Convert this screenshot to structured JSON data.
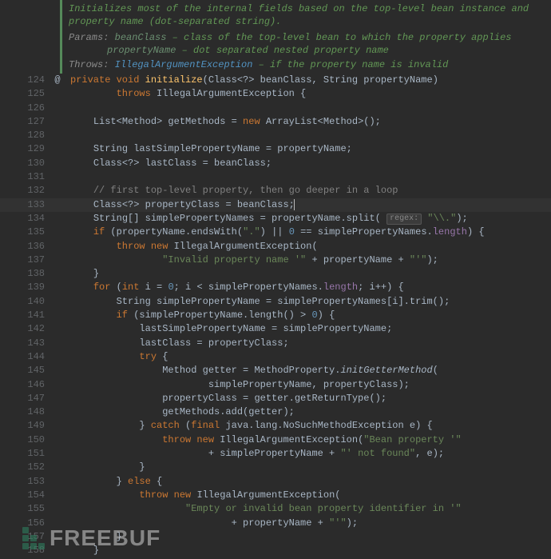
{
  "javadoc": {
    "summary": "Initializes most of the internal fields based on the top-level bean instance and property name (dot-separated string).",
    "params_label": "Params:",
    "params": [
      {
        "name": "beanClass",
        "desc": "– class of the top-level bean to which the property applies"
      },
      {
        "name": "propertyName",
        "desc": "– dot separated nested property name"
      }
    ],
    "throws_label": "Throws:",
    "throws": {
      "exception": "IllegalArgumentException",
      "desc": "– if the property name is invalid"
    }
  },
  "change_marker": "@",
  "lines": [
    {
      "n": 124,
      "indent": 0,
      "segs": [
        {
          "t": "private ",
          "c": "kw"
        },
        {
          "t": "void ",
          "c": "kw"
        },
        {
          "t": "initialize",
          "c": "mth"
        },
        {
          "t": "(Class<?> beanClass, String propertyName)"
        }
      ]
    },
    {
      "n": 125,
      "indent": 8,
      "segs": [
        {
          "t": "throws ",
          "c": "kw"
        },
        {
          "t": "IllegalArgumentException {"
        }
      ]
    },
    {
      "n": 126,
      "indent": 0,
      "segs": []
    },
    {
      "n": 127,
      "indent": 4,
      "segs": [
        {
          "t": "List<Method> getMethods = "
        },
        {
          "t": "new ",
          "c": "kw"
        },
        {
          "t": "ArrayList<Method>();"
        }
      ]
    },
    {
      "n": 128,
      "indent": 0,
      "segs": []
    },
    {
      "n": 129,
      "indent": 4,
      "segs": [
        {
          "t": "String lastSimplePropertyName = propertyName;"
        }
      ]
    },
    {
      "n": 130,
      "indent": 4,
      "segs": [
        {
          "t": "Class<?> lastClass = beanClass;"
        }
      ]
    },
    {
      "n": 131,
      "indent": 0,
      "segs": []
    },
    {
      "n": 132,
      "indent": 4,
      "segs": [
        {
          "t": "// first top-level property, then go deeper in a loop",
          "c": "cmt"
        }
      ]
    },
    {
      "n": 133,
      "indent": 4,
      "hl": true,
      "segs": [
        {
          "t": "Class<?> propertyClass = beanClass;"
        },
        {
          "t": "",
          "caret": true
        }
      ]
    },
    {
      "n": 134,
      "indent": 4,
      "segs": [
        {
          "t": "String[] simplePropertyNames = propertyName.split( "
        },
        {
          "t": "",
          "regex": "regex:"
        },
        {
          "t": " "
        },
        {
          "t": "\"",
          "c": "str"
        },
        {
          "t": "\\\\.",
          "c": "str"
        },
        {
          "t": "\"",
          "c": "str"
        },
        {
          "t": ");"
        }
      ]
    },
    {
      "n": 135,
      "indent": 4,
      "segs": [
        {
          "t": "if ",
          "c": "kw"
        },
        {
          "t": "(propertyName.endsWith("
        },
        {
          "t": "\".\"",
          "c": "str"
        },
        {
          "t": ") || "
        },
        {
          "t": "0",
          "c": "num"
        },
        {
          "t": " == simplePropertyNames."
        },
        {
          "t": "length",
          "c": "fld"
        },
        {
          "t": ") {"
        }
      ]
    },
    {
      "n": 136,
      "indent": 8,
      "segs": [
        {
          "t": "throw new ",
          "c": "kw"
        },
        {
          "t": "IllegalArgumentException("
        }
      ]
    },
    {
      "n": 137,
      "indent": 16,
      "segs": [
        {
          "t": "\"Invalid property name '\"",
          "c": "str"
        },
        {
          "t": " + propertyName + "
        },
        {
          "t": "\"'\"",
          "c": "str"
        },
        {
          "t": ");"
        }
      ]
    },
    {
      "n": 138,
      "indent": 4,
      "segs": [
        {
          "t": "}"
        }
      ]
    },
    {
      "n": 139,
      "indent": 4,
      "segs": [
        {
          "t": "for ",
          "c": "kw"
        },
        {
          "t": "("
        },
        {
          "t": "int ",
          "c": "kw"
        },
        {
          "t": "i = "
        },
        {
          "t": "0",
          "c": "num"
        },
        {
          "t": "; i < simplePropertyNames."
        },
        {
          "t": "length",
          "c": "fld"
        },
        {
          "t": "; i++) {"
        }
      ]
    },
    {
      "n": 140,
      "indent": 8,
      "segs": [
        {
          "t": "String simplePropertyName = simplePropertyNames[i].trim();"
        }
      ]
    },
    {
      "n": 141,
      "indent": 8,
      "segs": [
        {
          "t": "if ",
          "c": "kw"
        },
        {
          "t": "(simplePropertyName.length() > "
        },
        {
          "t": "0",
          "c": "num"
        },
        {
          "t": ") {"
        }
      ]
    },
    {
      "n": 142,
      "indent": 12,
      "segs": [
        {
          "t": "lastSimplePropertyName = simplePropertyName;"
        }
      ]
    },
    {
      "n": 143,
      "indent": 12,
      "segs": [
        {
          "t": "lastClass = propertyClass;"
        }
      ]
    },
    {
      "n": 144,
      "indent": 12,
      "segs": [
        {
          "t": "try ",
          "c": "kw"
        },
        {
          "t": "{"
        }
      ]
    },
    {
      "n": 145,
      "indent": 16,
      "segs": [
        {
          "t": "Method getter = MethodProperty."
        },
        {
          "t": "initGetterMethod",
          "c": "ital"
        },
        {
          "t": "("
        }
      ]
    },
    {
      "n": 146,
      "indent": 24,
      "segs": [
        {
          "t": "simplePropertyName, propertyClass);"
        }
      ]
    },
    {
      "n": 147,
      "indent": 16,
      "segs": [
        {
          "t": "propertyClass = getter.getReturnType();"
        }
      ]
    },
    {
      "n": 148,
      "indent": 16,
      "segs": [
        {
          "t": "getMethods.add(getter);"
        }
      ]
    },
    {
      "n": 149,
      "indent": 12,
      "segs": [
        {
          "t": "} "
        },
        {
          "t": "catch ",
          "c": "kw"
        },
        {
          "t": "("
        },
        {
          "t": "final ",
          "c": "kw"
        },
        {
          "t": "java.lang.NoSuchMethodException e) {"
        }
      ]
    },
    {
      "n": 150,
      "indent": 16,
      "segs": [
        {
          "t": "throw new ",
          "c": "kw"
        },
        {
          "t": "IllegalArgumentException("
        },
        {
          "t": "\"Bean property '\"",
          "c": "str"
        }
      ]
    },
    {
      "n": 151,
      "indent": 24,
      "segs": [
        {
          "t": "+ simplePropertyName + "
        },
        {
          "t": "\"' not found\"",
          "c": "str"
        },
        {
          "t": ", e);"
        }
      ]
    },
    {
      "n": 152,
      "indent": 12,
      "segs": [
        {
          "t": "}"
        }
      ]
    },
    {
      "n": 153,
      "indent": 8,
      "segs": [
        {
          "t": "} "
        },
        {
          "t": "else ",
          "c": "kw"
        },
        {
          "t": "{"
        }
      ]
    },
    {
      "n": 154,
      "indent": 12,
      "segs": [
        {
          "t": "throw new ",
          "c": "kw"
        },
        {
          "t": "IllegalArgumentException("
        }
      ]
    },
    {
      "n": 155,
      "indent": 20,
      "segs": [
        {
          "t": "\"Empty or invalid bean property identifier in '\"",
          "c": "str"
        }
      ]
    },
    {
      "n": 156,
      "indent": 28,
      "segs": [
        {
          "t": "+ propertyName + "
        },
        {
          "t": "\"'\"",
          "c": "str"
        },
        {
          "t": ");"
        }
      ]
    },
    {
      "n": 157,
      "indent": 8,
      "segs": [
        {
          "t": "}"
        }
      ]
    },
    {
      "n": 158,
      "indent": 4,
      "segs": [
        {
          "t": "}"
        }
      ]
    }
  ],
  "watermark": "FREEBUF"
}
